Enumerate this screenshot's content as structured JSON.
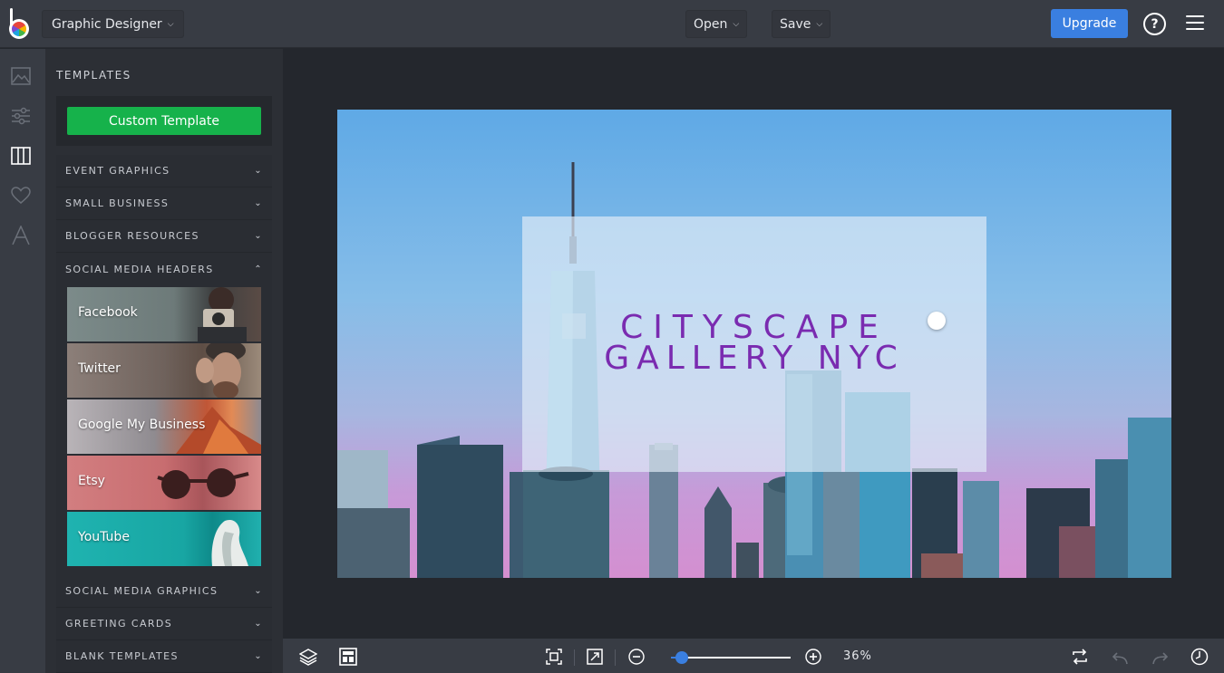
{
  "topbar": {
    "app_name": "Graphic Designer",
    "open_label": "Open",
    "save_label": "Save",
    "upgrade_label": "Upgrade",
    "help_label": "?"
  },
  "panel": {
    "title": "TEMPLATES",
    "custom_template_label": "Custom Template",
    "categories_top": [
      {
        "label": "EVENT GRAPHICS"
      },
      {
        "label": "SMALL BUSINESS"
      },
      {
        "label": "BLOGGER RESOURCES"
      },
      {
        "label": "SOCIAL MEDIA HEADERS"
      }
    ],
    "social_headers": [
      {
        "label": "Facebook"
      },
      {
        "label": "Twitter"
      },
      {
        "label": "Google My Business"
      },
      {
        "label": "Etsy"
      },
      {
        "label": "YouTube"
      }
    ],
    "categories_bottom": [
      {
        "label": "SOCIAL MEDIA GRAPHICS"
      },
      {
        "label": "GREETING CARDS"
      },
      {
        "label": "BLANK TEMPLATES"
      }
    ]
  },
  "canvas": {
    "headline_line1": "CITYSCAPE",
    "headline_line2": "GALLERY NYC",
    "text_color": "#7a2bb0"
  },
  "bottombar": {
    "zoom_label": "36%",
    "zoom_fraction": 0.09
  },
  "colors": {
    "accent": "#3a7fe0",
    "custom_button": "#16b24b",
    "topbar": "#383c44"
  }
}
